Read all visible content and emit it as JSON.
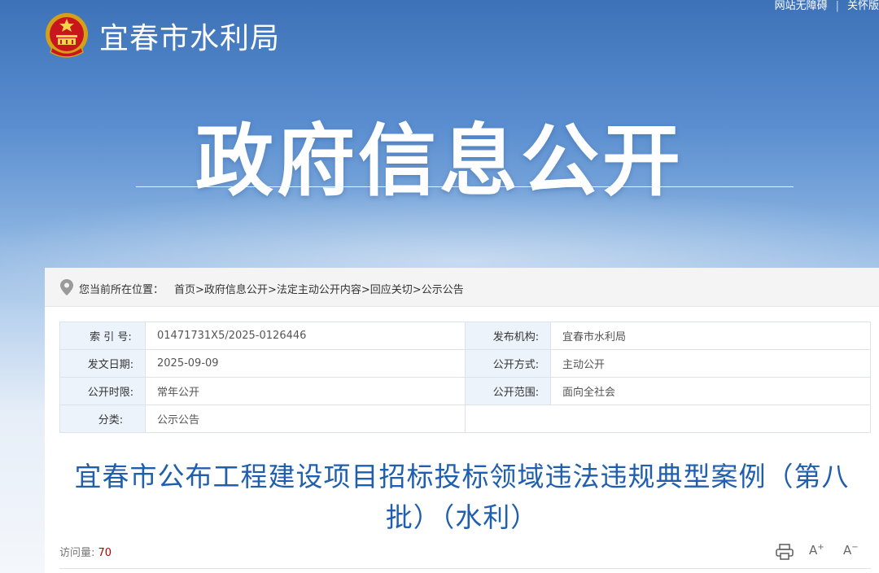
{
  "header": {
    "site_name": "宜春市水利局",
    "top_links": [
      "网站无障碍",
      "关怀版"
    ],
    "hero_title": "政府信息公开",
    "emblem_icon": "national-emblem-icon"
  },
  "breadcrumb": {
    "label": "您当前所在位置：",
    "items": [
      "首页",
      "政府信息公开",
      "法定主动公开内容",
      "回应关切",
      "公示公告"
    ],
    "separator": ">"
  },
  "meta": {
    "index_no_label": "索 引 号:",
    "index_no": "01471731X5/2025-0126446",
    "publisher_label": "发布机构:",
    "publisher": "宜春市水利局",
    "date_label": "发文日期:",
    "date": "2025-09-09",
    "method_label": "公开方式:",
    "method": "主动公开",
    "period_label": "公开时限:",
    "period": "常年公开",
    "scope_label": "公开范围:",
    "scope": "面向全社会",
    "category_label": "分类:",
    "category": "公示公告"
  },
  "article": {
    "title": "宜春市公布工程建设项目招标投标领域违法违规典型案例（第八批）（水利）",
    "visits_label": "访问量:",
    "visits": "70"
  },
  "toolbar": {
    "print_icon": "print-icon",
    "font_increase_icon": "font-increase-icon",
    "font_decrease_icon": "font-decrease-icon",
    "font_increase": "A",
    "font_decrease": "A"
  },
  "colors": {
    "accent_title": "#1f5fae",
    "visits_number": "#b30000",
    "table_label_bg": "#edf3fb"
  }
}
